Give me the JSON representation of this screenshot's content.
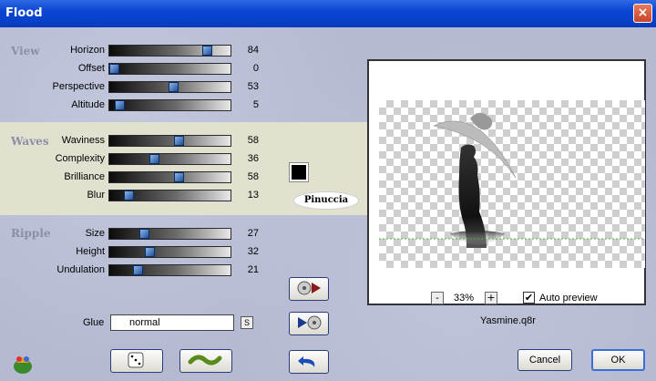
{
  "window": {
    "title": "Flood",
    "close": "×"
  },
  "groups": {
    "view": "View",
    "waves": "Waves",
    "ripple": "Ripple"
  },
  "sliders": [
    {
      "label": "Horizon",
      "value": "84",
      "fraction": 0.84
    },
    {
      "label": "Offset",
      "value": "0",
      "fraction": 0.0
    },
    {
      "label": "Perspective",
      "value": "53",
      "fraction": 0.53
    },
    {
      "label": "Altitude",
      "value": "5",
      "fraction": 0.05
    },
    {
      "label": "Waviness",
      "value": "58",
      "fraction": 0.58
    },
    {
      "label": "Complexity",
      "value": "36",
      "fraction": 0.36
    },
    {
      "label": "Brilliance",
      "value": "58",
      "fraction": 0.58
    },
    {
      "label": "Blur",
      "value": "13",
      "fraction": 0.13
    },
    {
      "label": "Size",
      "value": "27",
      "fraction": 0.27
    },
    {
      "label": "Height",
      "value": "32",
      "fraction": 0.32
    },
    {
      "label": "Undulation",
      "value": "21",
      "fraction": 0.21
    }
  ],
  "color_swatch": "#000000",
  "logo_text": "Pinuccia",
  "glue": {
    "label": "Glue",
    "value": "normal",
    "s_button": "S"
  },
  "zoom": {
    "minus": "-",
    "value": "33%",
    "plus": "+"
  },
  "auto_preview": {
    "label": "Auto preview",
    "checked": true
  },
  "filename": "Yasmine.q8r",
  "buttons": {
    "cancel": "Cancel",
    "ok": "OK"
  },
  "icons": [
    "app-logo-icon",
    "dice-icon",
    "wave-icon",
    "record-play-icon",
    "play-record-icon",
    "undo-icon"
  ]
}
